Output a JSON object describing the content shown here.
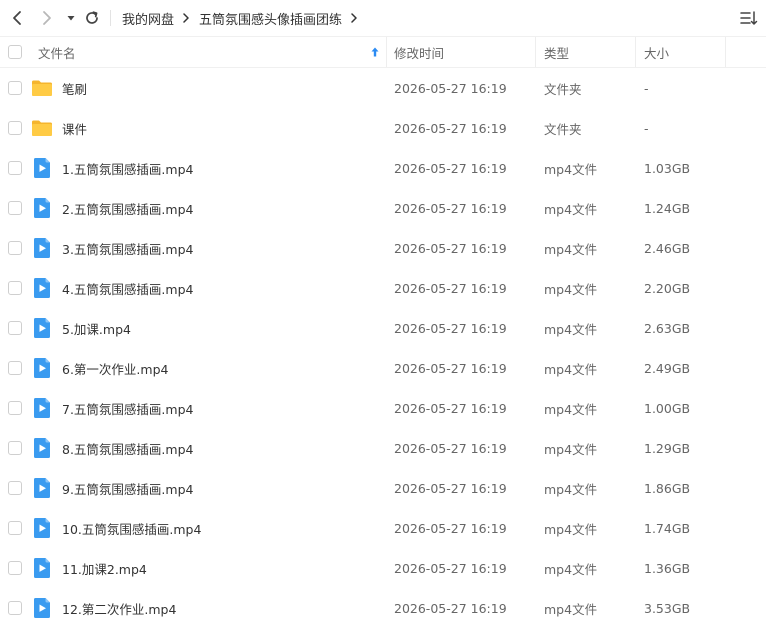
{
  "toolbar": {
    "back_icon": "chevron-left-icon",
    "forward_icon": "chevron-right-icon",
    "history_icon": "caret-down-icon",
    "refresh_icon": "refresh-icon",
    "view_icon": "sort-list-icon"
  },
  "breadcrumb": {
    "items": [
      "我的网盘",
      "五筒氛围感头像插画团练"
    ]
  },
  "columns": {
    "name": "文件名",
    "modified": "修改时间",
    "type": "类型",
    "size": "大小"
  },
  "colors": {
    "folder": "#FFC53D",
    "video": "#3A9BF0",
    "accent": "#2B8BF3"
  },
  "files": [
    {
      "name": "笔刷",
      "modified": "2026-05-27 16:19",
      "type": "文件夹",
      "size": "-",
      "icon": "folder-icon"
    },
    {
      "name": "课件",
      "modified": "2026-05-27 16:19",
      "type": "文件夹",
      "size": "-",
      "icon": "folder-icon"
    },
    {
      "name": "1.五筒氛围感插画.mp4",
      "modified": "2026-05-27 16:19",
      "type": "mp4文件",
      "size": "1.03GB",
      "icon": "video-file-icon"
    },
    {
      "name": "2.五筒氛围感插画.mp4",
      "modified": "2026-05-27 16:19",
      "type": "mp4文件",
      "size": "1.24GB",
      "icon": "video-file-icon"
    },
    {
      "name": "3.五筒氛围感插画.mp4",
      "modified": "2026-05-27 16:19",
      "type": "mp4文件",
      "size": "2.46GB",
      "icon": "video-file-icon"
    },
    {
      "name": "4.五筒氛围感插画.mp4",
      "modified": "2026-05-27 16:19",
      "type": "mp4文件",
      "size": "2.20GB",
      "icon": "video-file-icon"
    },
    {
      "name": "5.加课.mp4",
      "modified": "2026-05-27 16:19",
      "type": "mp4文件",
      "size": "2.63GB",
      "icon": "video-file-icon"
    },
    {
      "name": "6.第一次作业.mp4",
      "modified": "2026-05-27 16:19",
      "type": "mp4文件",
      "size": "2.49GB",
      "icon": "video-file-icon"
    },
    {
      "name": "7.五筒氛围感插画.mp4",
      "modified": "2026-05-27 16:19",
      "type": "mp4文件",
      "size": "1.00GB",
      "icon": "video-file-icon"
    },
    {
      "name": "8.五筒氛围感插画.mp4",
      "modified": "2026-05-27 16:19",
      "type": "mp4文件",
      "size": "1.29GB",
      "icon": "video-file-icon"
    },
    {
      "name": "9.五筒氛围感插画.mp4",
      "modified": "2026-05-27 16:19",
      "type": "mp4文件",
      "size": "1.86GB",
      "icon": "video-file-icon"
    },
    {
      "name": "10.五筒氛围感插画.mp4",
      "modified": "2026-05-27 16:19",
      "type": "mp4文件",
      "size": "1.74GB",
      "icon": "video-file-icon"
    },
    {
      "name": "11.加课2.mp4",
      "modified": "2026-05-27 16:19",
      "type": "mp4文件",
      "size": "1.36GB",
      "icon": "video-file-icon"
    },
    {
      "name": "12.第二次作业.mp4",
      "modified": "2026-05-27 16:19",
      "type": "mp4文件",
      "size": "3.53GB",
      "icon": "video-file-icon"
    }
  ]
}
